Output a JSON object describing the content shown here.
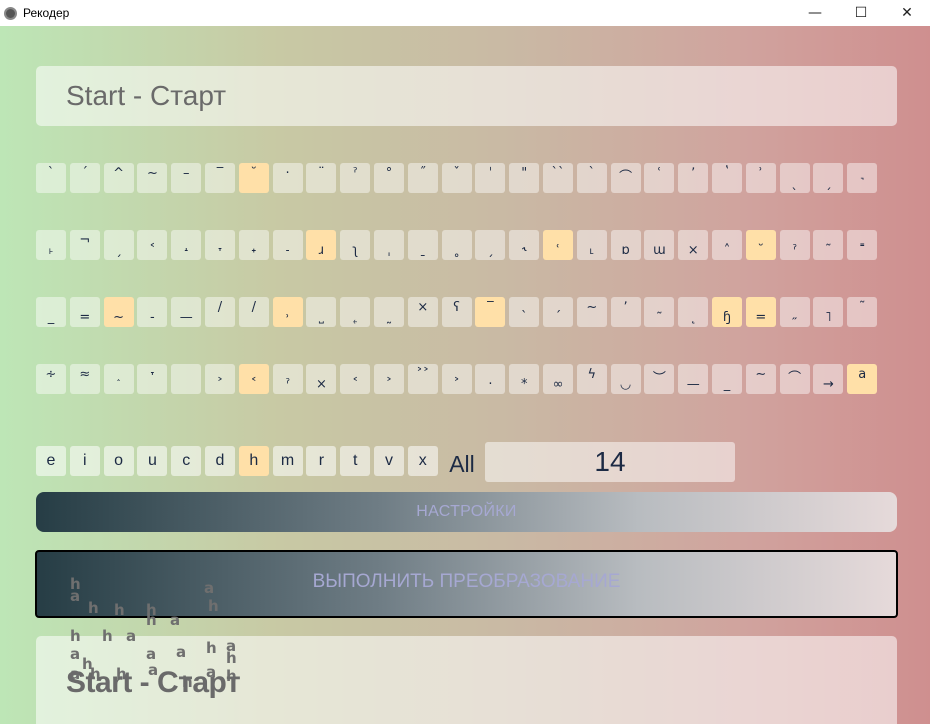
{
  "window": {
    "title": "Рекодер",
    "minimize": "—",
    "maximize": "☐",
    "close": "✕"
  },
  "input": {
    "value": "Start - Старт"
  },
  "keys": {
    "row1": [
      "`",
      "´",
      "^",
      "~",
      "–",
      "‾",
      "˘",
      "·",
      "¨",
      "ˀ",
      "°",
      "˝",
      "ˇ",
      "ˈ",
      "\"",
      "``",
      "ˋ",
      "⌒",
      "ʿ",
      "ʼ",
      "ʽ",
      "ʾ",
      "ˎ",
      "ˏ",
      "˺"
    ],
    "row2": [
      "˫",
      "¬",
      "ˏ",
      "˂",
      "˔",
      "˕",
      "˖",
      "˗",
      "ɹ",
      "ʅ",
      "ˌ",
      "ˍ",
      "˳",
      "ˏ",
      "˞",
      "ʿ",
      "˪",
      "ɒ",
      "ɯ",
      "×",
      "˄",
      "˘",
      "ˀ",
      "˜",
      "˭"
    ],
    "row3": [
      "_",
      "=",
      "~",
      "-",
      "—",
      "/",
      "/",
      "˒",
      "˽",
      "˿",
      "˷",
      "×",
      "ʕ",
      "‾",
      "`",
      "´",
      "~",
      "ʼ",
      "˷",
      "˛",
      "ɧ",
      "=",
      "˶",
      "˥",
      "˜"
    ],
    "row4": [
      "∻",
      "≈",
      "˰",
      "˕",
      "",
      "˃",
      "˂",
      "ˀ",
      "×",
      "˂",
      "˃",
      "˃˃",
      "˃",
      "·",
      "*",
      "∞",
      "ϟ",
      "◡",
      "︶",
      "—",
      "_",
      "∼",
      "⌒",
      "→",
      "a"
    ]
  },
  "filters": {
    "letters": [
      "e",
      "i",
      "o",
      "u",
      "c",
      "d",
      "h",
      "m",
      "r",
      "t",
      "v",
      "x"
    ],
    "all_label": "All",
    "count": "14"
  },
  "settings_button": "НАСТРОЙКИ",
  "run_button": "ВЫПОЛНИТЬ ПРЕОБРАЗОВАНИЕ",
  "output": {
    "value": "Start - Старт"
  },
  "overlay": {
    "glyphs": [
      "h",
      "a",
      "h",
      "h",
      "a",
      "h",
      "h",
      "a",
      "h",
      "a",
      "a",
      "h",
      "a",
      "h",
      "h",
      "a",
      "h",
      "h",
      "a",
      "h",
      "a",
      "h",
      "a",
      "a",
      "h",
      "h"
    ]
  },
  "colors": {
    "highlight": "#ffe0a8",
    "text_dark": "#1c2a44",
    "button_text": "#a6a8d2"
  }
}
